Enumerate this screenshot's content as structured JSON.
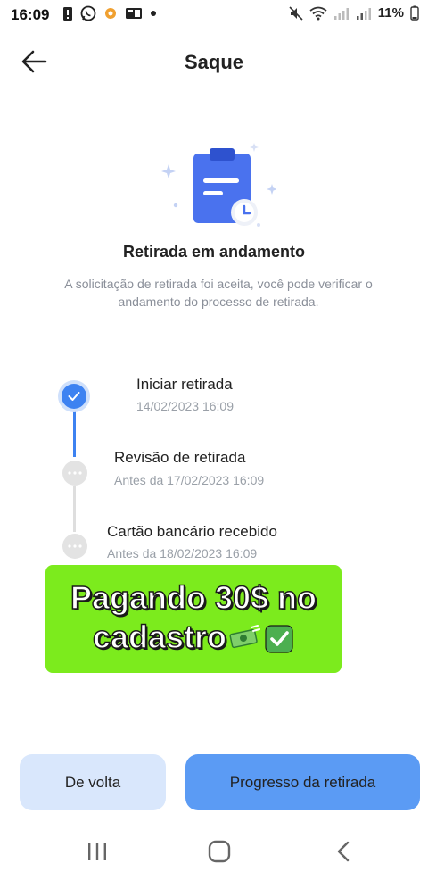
{
  "status_bar": {
    "time": "16:09",
    "battery": "11%",
    "icons_left": [
      "alert-icon",
      "whatsapp-icon",
      "app-icon",
      "gallery-icon",
      "dot-icon"
    ],
    "icons_right": [
      "mute-icon",
      "wifi-icon",
      "signal-icon",
      "signal-icon"
    ]
  },
  "header": {
    "title": "Saque",
    "back_icon": "arrow-left-icon"
  },
  "hero": {
    "icon": "clipboard-clock-icon",
    "title": "Retirada em andamento",
    "description": "A solicitação de retirada foi aceita, você pode verificar o andamento do processo de retirada."
  },
  "timeline": {
    "steps": [
      {
        "title": "Iniciar retirada",
        "time": "14/02/2023 16:09",
        "status": "done"
      },
      {
        "title": "Revisão de retirada",
        "time": "Antes da 17/02/2023 16:09",
        "status": "pending"
      },
      {
        "title": "Cartão bancário recebido",
        "time": "Antes da 18/02/2023 16:09",
        "status": "pending"
      }
    ]
  },
  "promo": {
    "line1": "Pagando 30$ no",
    "line2": "cadastro",
    "icons": [
      "money-icon",
      "check-mark-icon"
    ],
    "background": "#7ceb1d"
  },
  "buttons": {
    "back_label": "De volta",
    "progress_label": "Progresso da retirada"
  },
  "colors": {
    "accent": "#3d82f1",
    "primary_button": "#5b9bf4",
    "secondary_button": "#d9e7fc"
  }
}
